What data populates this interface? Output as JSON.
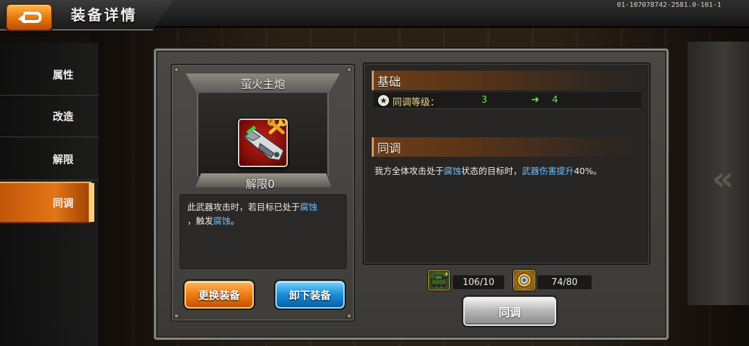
{
  "header": {
    "title": "装备详情",
    "build_id": "01-107078742-2581.0-101-1"
  },
  "sidebar": {
    "tabs": [
      {
        "label": "属性",
        "active": false
      },
      {
        "label": "改造",
        "active": false
      },
      {
        "label": "解限",
        "active": false
      },
      {
        "label": "同调",
        "active": true
      }
    ]
  },
  "equipment": {
    "name": "萤火主炮",
    "limit_label": "解限0",
    "icon": "cannon-weapon-icon",
    "badge_icon": "wrench-icon",
    "description_parts": [
      "此武器攻击时，若目标已处于",
      "腐蚀",
      "，触发",
      "腐蚀",
      "。"
    ]
  },
  "actions": {
    "replace_label": "更换装备",
    "unequip_label": "卸下装备",
    "sync_label": "同调"
  },
  "basics": {
    "heading": "基础",
    "stat_label": "同调等级：",
    "from_value": "3",
    "to_value": "4",
    "star_icon": "star-icon",
    "arrow_icon": "right-arrow-icon"
  },
  "sync": {
    "heading": "同调",
    "effect_parts": [
      "我方全体攻击处于",
      "腐蚀",
      "状态的目标时，",
      "武器伤害提升",
      "40%。"
    ]
  },
  "resources": [
    {
      "icon": "tank-material-icon",
      "value": "106/10"
    },
    {
      "icon": "gear-coin-icon",
      "value": "74/80"
    }
  ],
  "colors": {
    "accent_orange": "#e37516",
    "highlight_blue": "#6fbfff",
    "stat_green": "#59e859"
  }
}
